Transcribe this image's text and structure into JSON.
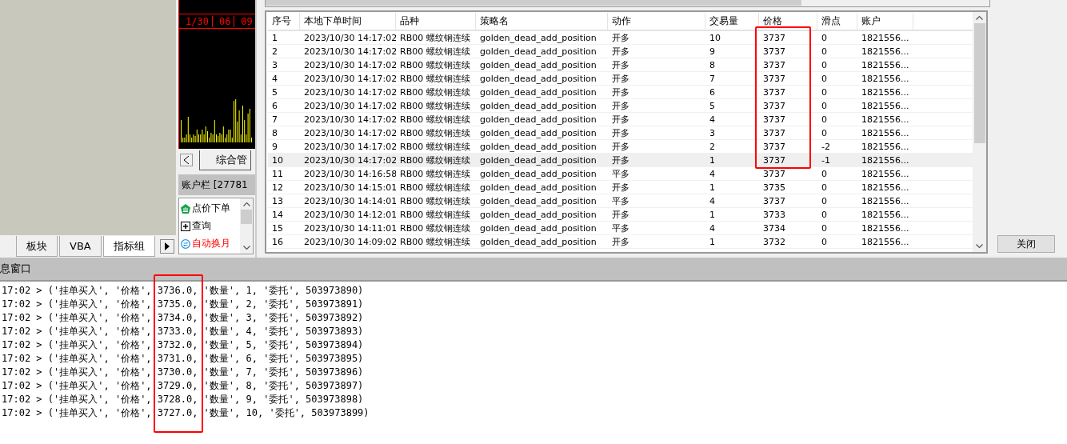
{
  "left_panel": {
    "tabs": [
      {
        "label": "板块",
        "selected": false
      },
      {
        "label": "VBA",
        "selected": false
      },
      {
        "label": "指标组",
        "selected": true
      }
    ]
  },
  "chart": {
    "axis_labels": [
      "1/30",
      "06",
      "09"
    ],
    "tab": "综合管"
  },
  "account_panel": {
    "title": "账户栏 [27781",
    "items": [
      {
        "label": "点价下单",
        "kind": "order",
        "highlighted": false
      },
      {
        "label": "查询",
        "kind": "query",
        "highlighted": false
      },
      {
        "label": "自动换月",
        "kind": "rollover",
        "highlighted": true
      }
    ]
  },
  "table": {
    "columns": [
      "序号",
      "本地下单时间",
      "品种",
      "策略名",
      "动作",
      "交易量",
      "价格",
      "滑点",
      "账户"
    ],
    "rows": [
      {
        "selected": false,
        "cells": [
          "1",
          "2023/10/30 14:17:02",
          "RB00 螺纹钢连续",
          "golden_dead_add_position",
          "开多",
          "10",
          "3737",
          "0",
          "1821556..."
        ]
      },
      {
        "selected": false,
        "cells": [
          "2",
          "2023/10/30 14:17:02",
          "RB00 螺纹钢连续",
          "golden_dead_add_position",
          "开多",
          "9",
          "3737",
          "0",
          "1821556..."
        ]
      },
      {
        "selected": false,
        "cells": [
          "3",
          "2023/10/30 14:17:02",
          "RB00 螺纹钢连续",
          "golden_dead_add_position",
          "开多",
          "8",
          "3737",
          "0",
          "1821556..."
        ]
      },
      {
        "selected": false,
        "cells": [
          "4",
          "2023/10/30 14:17:02",
          "RB00 螺纹钢连续",
          "golden_dead_add_position",
          "开多",
          "7",
          "3737",
          "0",
          "1821556..."
        ]
      },
      {
        "selected": false,
        "cells": [
          "5",
          "2023/10/30 14:17:02",
          "RB00 螺纹钢连续",
          "golden_dead_add_position",
          "开多",
          "6",
          "3737",
          "0",
          "1821556..."
        ]
      },
      {
        "selected": false,
        "cells": [
          "6",
          "2023/10/30 14:17:02",
          "RB00 螺纹钢连续",
          "golden_dead_add_position",
          "开多",
          "5",
          "3737",
          "0",
          "1821556..."
        ]
      },
      {
        "selected": false,
        "cells": [
          "7",
          "2023/10/30 14:17:02",
          "RB00 螺纹钢连续",
          "golden_dead_add_position",
          "开多",
          "4",
          "3737",
          "0",
          "1821556..."
        ]
      },
      {
        "selected": false,
        "cells": [
          "8",
          "2023/10/30 14:17:02",
          "RB00 螺纹钢连续",
          "golden_dead_add_position",
          "开多",
          "3",
          "3737",
          "0",
          "1821556..."
        ]
      },
      {
        "selected": false,
        "cells": [
          "9",
          "2023/10/30 14:17:02",
          "RB00 螺纹钢连续",
          "golden_dead_add_position",
          "开多",
          "2",
          "3737",
          "-2",
          "1821556..."
        ]
      },
      {
        "selected": true,
        "cells": [
          "10",
          "2023/10/30 14:17:02",
          "RB00 螺纹钢连续",
          "golden_dead_add_position",
          "开多",
          "1",
          "3737",
          "-1",
          "1821556..."
        ]
      },
      {
        "selected": false,
        "cells": [
          "11",
          "2023/10/30 14:16:58",
          "RB00 螺纹钢连续",
          "golden_dead_add_position",
          "平多",
          "4",
          "3737",
          "0",
          "1821556..."
        ]
      },
      {
        "selected": false,
        "cells": [
          "12",
          "2023/10/30 14:15:01",
          "RB00 螺纹钢连续",
          "golden_dead_add_position",
          "开多",
          "1",
          "3735",
          "0",
          "1821556..."
        ]
      },
      {
        "selected": false,
        "cells": [
          "13",
          "2023/10/30 14:14:01",
          "RB00 螺纹钢连续",
          "golden_dead_add_position",
          "平多",
          "4",
          "3737",
          "0",
          "1821556..."
        ]
      },
      {
        "selected": false,
        "cells": [
          "14",
          "2023/10/30 14:12:01",
          "RB00 螺纹钢连续",
          "golden_dead_add_position",
          "开多",
          "1",
          "3733",
          "0",
          "1821556..."
        ]
      },
      {
        "selected": false,
        "cells": [
          "15",
          "2023/10/30 14:11:01",
          "RB00 螺纹钢连续",
          "golden_dead_add_position",
          "平多",
          "4",
          "3734",
          "0",
          "1821556..."
        ]
      },
      {
        "selected": false,
        "cells": [
          "16",
          "2023/10/30 14:09:02",
          "RB00 螺纹钢连续",
          "golden_dead_add_position",
          "开多",
          "1",
          "3732",
          "0",
          "1821556..."
        ]
      }
    ]
  },
  "close_button": "关闭",
  "log": {
    "title": "息窗口",
    "lines": [
      "17:02 > ('挂单买入', '价格', 3736.0, '数量', 1, '委托', 503973890)",
      "17:02 > ('挂单买入', '价格', 3735.0, '数量', 2, '委托', 503973891)",
      "17:02 > ('挂单买入', '价格', 3734.0, '数量', 3, '委托', 503973892)",
      "17:02 > ('挂单买入', '价格', 3733.0, '数量', 4, '委托', 503973893)",
      "17:02 > ('挂单买入', '价格', 3732.0, '数量', 5, '委托', 503973894)",
      "17:02 > ('挂单买入', '价格', 3731.0, '数量', 6, '委托', 503973895)",
      "17:02 > ('挂单买入', '价格', 3730.0, '数量', 7, '委托', 503973896)",
      "17:02 > ('挂单买入', '价格', 3729.0, '数量', 8, '委托', 503973897)",
      "17:02 > ('挂单买入', '价格', 3728.0, '数量', 9, '委托', 503973898)",
      "17:02 > ('挂单买入', '价格', 3727.0, '数量', 10, '委托', 503973899)"
    ]
  }
}
